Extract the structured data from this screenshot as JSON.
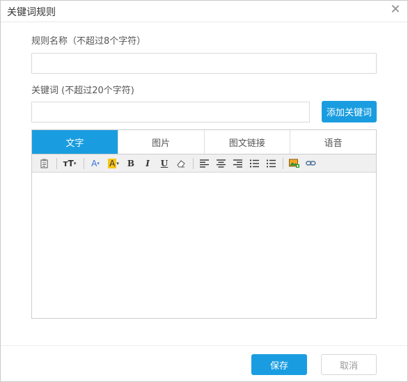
{
  "dialog": {
    "title": "关键词规则"
  },
  "form": {
    "rule_name_label": "规则名称（不超过8个字符）",
    "rule_name_value": "",
    "keyword_label": "关键词 (不超过20个字符)",
    "keyword_value": "",
    "add_keyword_label": "添加关键词"
  },
  "editor": {
    "tabs": [
      {
        "label": "文字",
        "active": true
      },
      {
        "label": "图片",
        "active": false
      },
      {
        "label": "图文链接",
        "active": false
      },
      {
        "label": "语音",
        "active": false
      }
    ],
    "toolbar_icons": [
      "paste-icon",
      "font-size-icon",
      "font-color-icon",
      "highlight-icon",
      "bold-icon",
      "italic-icon",
      "underline-icon",
      "eraser-icon",
      "align-left-icon",
      "align-center-icon",
      "align-right-icon",
      "ordered-list-icon",
      "unordered-list-icon",
      "image-icon",
      "link-icon"
    ],
    "toolbar_glyphs": {
      "font_size": "ᴛT",
      "font_color": "A",
      "highlight": "A",
      "bold": "B",
      "italic": "I",
      "underline": "U"
    },
    "content": ""
  },
  "footer": {
    "save_label": "保存",
    "cancel_label": "取消"
  },
  "colors": {
    "primary": "#1a9de0",
    "highlight": "#f5c518",
    "font_color": "#3a6fd8"
  }
}
